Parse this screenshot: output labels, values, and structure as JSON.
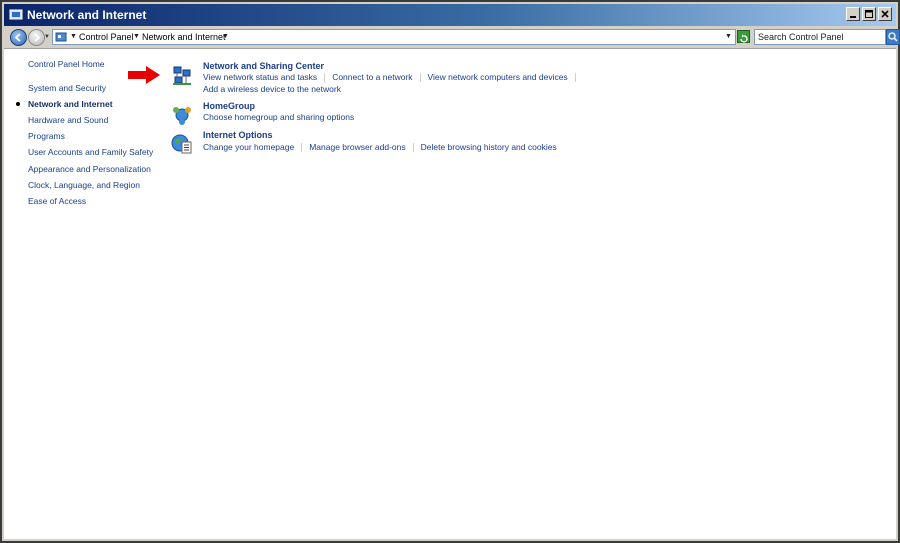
{
  "window": {
    "title": "Network and Internet"
  },
  "address": {
    "crumbs": [
      "Control Panel",
      "Network and Internet"
    ],
    "search_placeholder": "Search Control Panel"
  },
  "sidebar": {
    "home": "Control Panel Home",
    "items": [
      "System and Security",
      "Network and Internet",
      "Hardware and Sound",
      "Programs",
      "User Accounts and Family Safety",
      "Appearance and Personalization",
      "Clock, Language, and Region",
      "Ease of Access"
    ],
    "current": "Network and Internet"
  },
  "categories": [
    {
      "title": "Network and Sharing Center",
      "icon": "network-sharing-icon",
      "links": [
        "View network status and tasks",
        "Connect to a network",
        "View network computers and devices"
      ],
      "links2": [
        "Add a wireless device to the network"
      ]
    },
    {
      "title": "HomeGroup",
      "icon": "homegroup-icon",
      "links": [
        "Choose homegroup and sharing options"
      ]
    },
    {
      "title": "Internet Options",
      "icon": "internet-options-icon",
      "links": [
        "Change your homepage",
        "Manage browser add-ons",
        "Delete browsing history and cookies"
      ]
    }
  ],
  "colors": {
    "link": "#1c3e8c",
    "title_bar": "#0a246a",
    "arrow": "#e60000"
  }
}
